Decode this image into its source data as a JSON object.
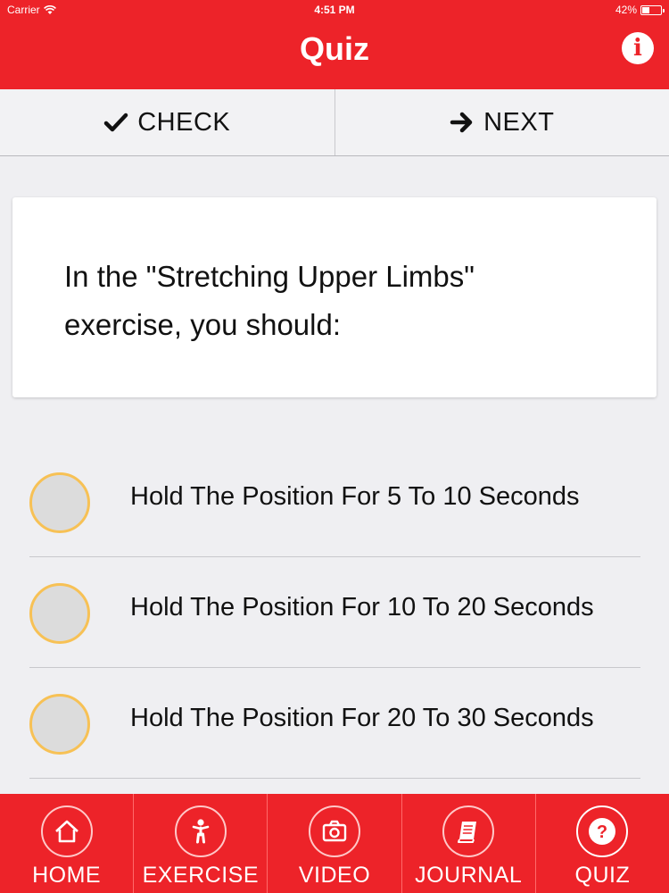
{
  "status_bar": {
    "carrier": "Carrier",
    "time": "4:51 PM",
    "battery_percent": "42%",
    "battery_level": 0.42
  },
  "header": {
    "title": "Quiz",
    "info_icon": "info-icon",
    "background": "#ed2329"
  },
  "toolbar": {
    "check_label": "CHECK",
    "check_icon": "checkmark-icon",
    "next_label": "NEXT",
    "next_icon": "arrow-right-icon"
  },
  "question": {
    "text": "In the \"Stretching Upper Limbs\" exercise, you should:"
  },
  "options": [
    {
      "label": "Hold The Position For 5 To 10 Seconds",
      "selected": false
    },
    {
      "label": "Hold The Position For 10 To 20 Seconds",
      "selected": false
    },
    {
      "label": "Hold The Position For 20 To 30 Seconds",
      "selected": false
    }
  ],
  "tabs": [
    {
      "label": "HOME",
      "icon": "home-icon"
    },
    {
      "label": "EXERCISE",
      "icon": "person-icon"
    },
    {
      "label": "VIDEO",
      "icon": "camera-icon"
    },
    {
      "label": "JOURNAL",
      "icon": "book-icon"
    },
    {
      "label": "QUIZ",
      "icon": "question-icon",
      "active": true
    }
  ],
  "colors": {
    "accent": "#ed2329",
    "radio_border": "#f7c155",
    "radio_fill": "#dcdcdc"
  }
}
